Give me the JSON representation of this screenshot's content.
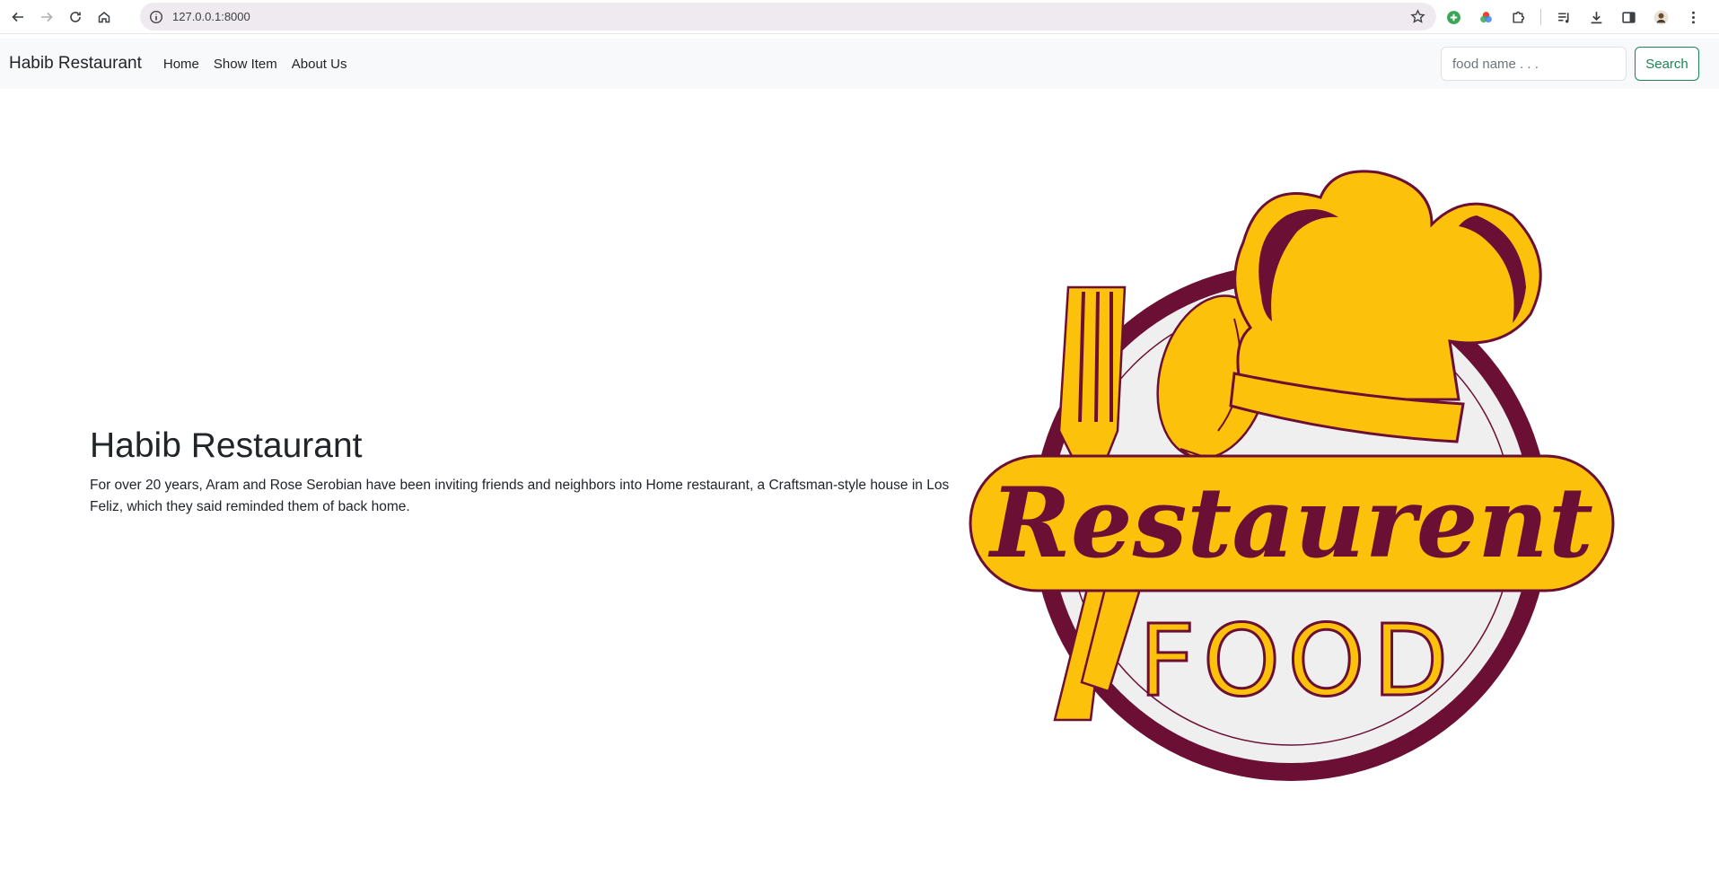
{
  "browser": {
    "url": "127.0.0.1:8000",
    "icons": [
      "back-icon",
      "forward-icon",
      "reload-icon",
      "home-icon",
      "site-info-icon",
      "bookmark-star-icon",
      "extension-green-icon",
      "extension-color-icon",
      "extensions-puzzle-icon",
      "reading-list-icon",
      "download-icon",
      "side-panel-icon",
      "profile-avatar-icon",
      "menu-icon"
    ]
  },
  "navbar": {
    "brand": "Habib Restaurant",
    "links": [
      "Home",
      "Show Item",
      "About Us"
    ],
    "search_placeholder": "food name . . .",
    "search_label": "Search"
  },
  "hero": {
    "title": "Habib Restaurant",
    "description": "For over 20 years, Aram and Rose Serobian have been inviting friends and neighbors into Home restaurant, a Craftsman-style house in Los Feliz, which they said reminded them of back home."
  },
  "logo": {
    "word_top": "Restaurent",
    "word_bottom": "FOOD",
    "colors": {
      "gold": "#fcc10a",
      "maroon": "#6b0f35",
      "plate": "#eeeeee"
    }
  }
}
